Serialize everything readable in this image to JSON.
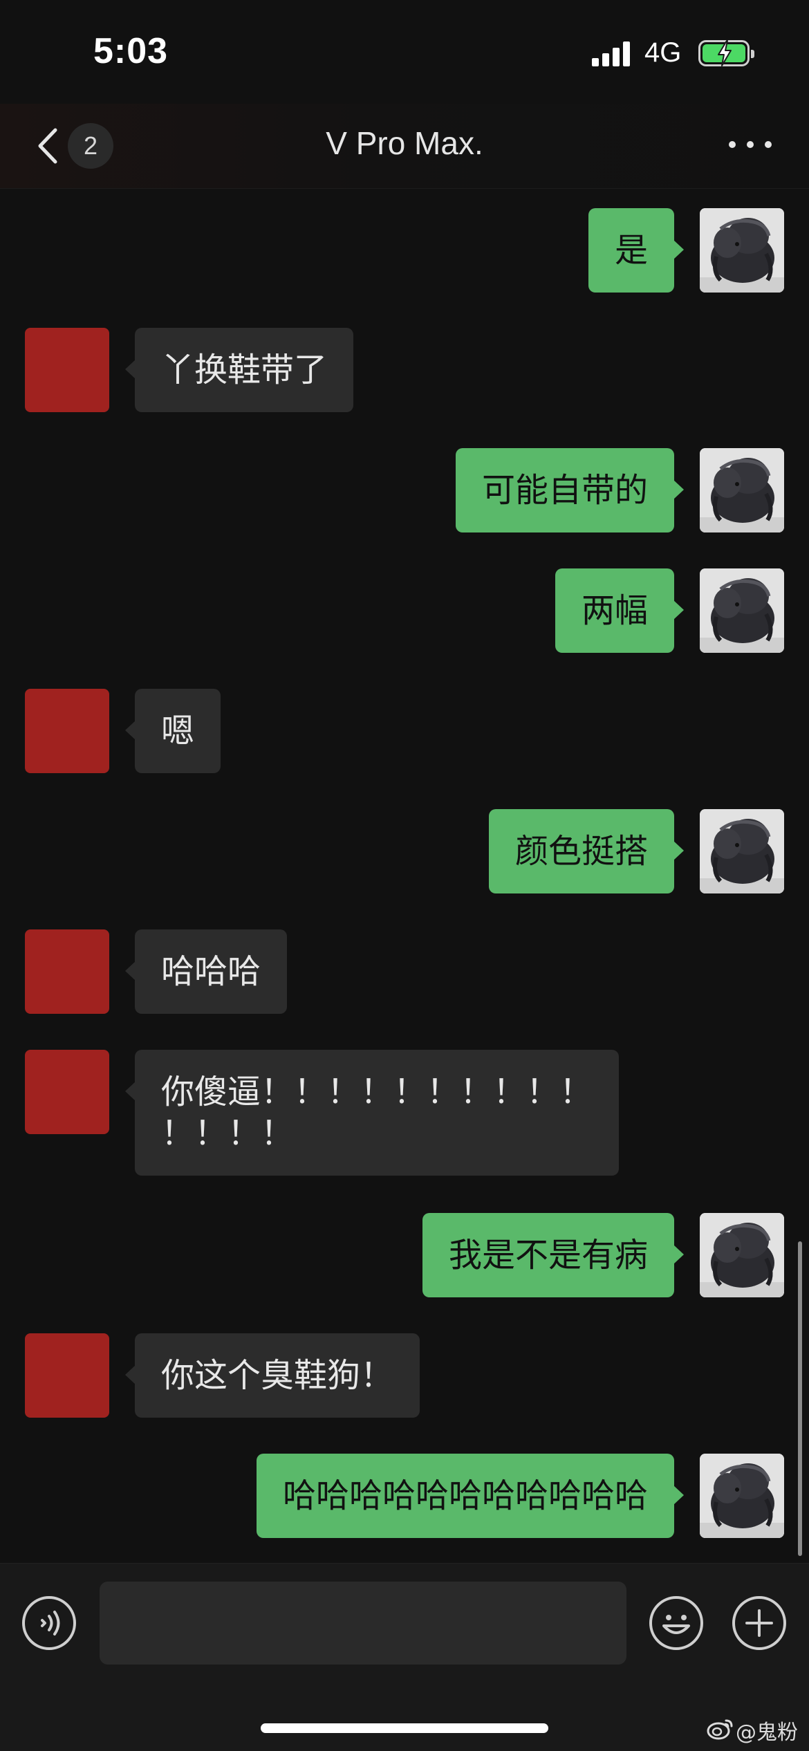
{
  "status_bar": {
    "time": "5:03",
    "network": "4G",
    "battery_state": "charging",
    "signal_bars": 4
  },
  "nav": {
    "unread_count": "2",
    "title": "V Pro Max.",
    "back_icon": "chevron-left-icon",
    "more_icon": "more-dots-icon"
  },
  "messages": [
    {
      "side": "out",
      "text": "是"
    },
    {
      "side": "in",
      "text": "丫换鞋带了"
    },
    {
      "side": "out",
      "text": "可能自带的"
    },
    {
      "side": "out",
      "text": "两幅"
    },
    {
      "side": "in",
      "text": "嗯"
    },
    {
      "side": "out",
      "text": "颜色挺搭"
    },
    {
      "side": "in",
      "text": "哈哈哈"
    },
    {
      "side": "in",
      "text": "你傻逼！！！！！！！！！！\n！！！！"
    },
    {
      "side": "out",
      "text": "我是不是有病"
    },
    {
      "side": "in",
      "text": "你这个臭鞋狗！"
    },
    {
      "side": "out",
      "text": "哈哈哈哈哈哈哈哈哈哈哈"
    }
  ],
  "input_bar": {
    "voice_icon": "voice-icon",
    "emoji_icon": "emoji-icon",
    "plus_icon": "plus-icon",
    "message_value": ""
  },
  "watermark": {
    "text": "@鬼粉",
    "icon": "weibo-icon"
  },
  "colors": {
    "background": "#111111",
    "outgoing_bubble": "#5ab96a",
    "incoming_bubble": "#2c2c2c",
    "incoming_avatar": "#a0221f",
    "battery_charging": "#4cd964"
  }
}
